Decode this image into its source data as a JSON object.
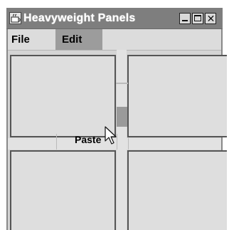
{
  "window": {
    "title": "Heavyweight Panels",
    "icon": "java-app-icon",
    "controls": [
      "minimize-icon",
      "maximize-icon",
      "close-icon"
    ]
  },
  "menubar": {
    "items": [
      {
        "label": "File"
      },
      {
        "label": "Edit"
      }
    ]
  },
  "popup": {
    "visible_item": "Paste"
  },
  "cursor": "arrow-pointer-icon"
}
